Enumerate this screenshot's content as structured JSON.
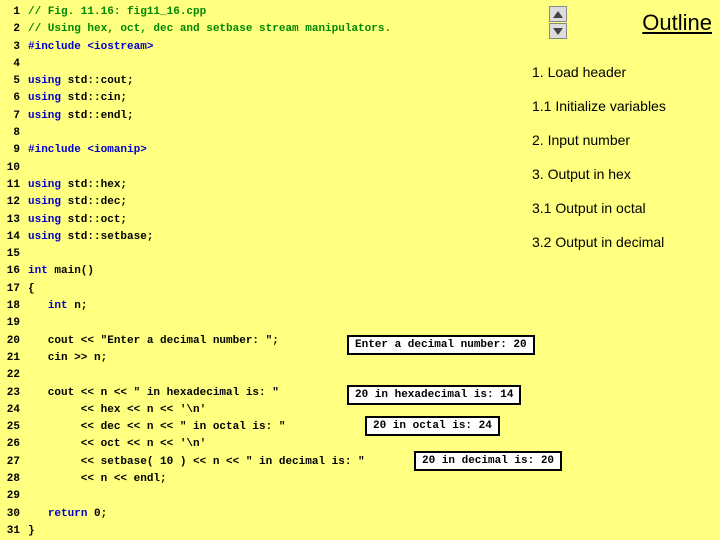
{
  "code": {
    "lines": [
      {
        "n": 1,
        "segs": [
          {
            "cls": "cmt",
            "t": "// Fig. 11.16: fig11_16.cpp"
          }
        ]
      },
      {
        "n": 2,
        "segs": [
          {
            "cls": "cmt",
            "t": "// Using hex, oct, dec and setbase stream manipulators."
          }
        ]
      },
      {
        "n": 3,
        "segs": [
          {
            "cls": "kwblue",
            "t": "#include <iostream>"
          }
        ]
      },
      {
        "n": 4,
        "segs": []
      },
      {
        "n": 5,
        "segs": [
          {
            "cls": "kwblue",
            "t": "using "
          },
          {
            "cls": "kw",
            "t": "std::cout;"
          }
        ]
      },
      {
        "n": 6,
        "segs": [
          {
            "cls": "kwblue",
            "t": "using "
          },
          {
            "cls": "kw",
            "t": "std::cin;"
          }
        ]
      },
      {
        "n": 7,
        "segs": [
          {
            "cls": "kwblue",
            "t": "using "
          },
          {
            "cls": "kw",
            "t": "std::endl;"
          }
        ]
      },
      {
        "n": 8,
        "segs": []
      },
      {
        "n": 9,
        "segs": [
          {
            "cls": "kwblue",
            "t": "#include <iomanip>"
          }
        ]
      },
      {
        "n": 10,
        "segs": []
      },
      {
        "n": 11,
        "segs": [
          {
            "cls": "kwblue",
            "t": "using "
          },
          {
            "cls": "kw",
            "t": "std::hex;"
          }
        ]
      },
      {
        "n": 12,
        "segs": [
          {
            "cls": "kwblue",
            "t": "using "
          },
          {
            "cls": "kw",
            "t": "std::dec;"
          }
        ]
      },
      {
        "n": 13,
        "segs": [
          {
            "cls": "kwblue",
            "t": "using "
          },
          {
            "cls": "kw",
            "t": "std::oct;"
          }
        ]
      },
      {
        "n": 14,
        "segs": [
          {
            "cls": "kwblue",
            "t": "using "
          },
          {
            "cls": "kw",
            "t": "std::setbase;"
          }
        ]
      },
      {
        "n": 15,
        "segs": []
      },
      {
        "n": 16,
        "segs": [
          {
            "cls": "kwblue",
            "t": "int "
          },
          {
            "cls": "kw",
            "t": "main()"
          }
        ]
      },
      {
        "n": 17,
        "segs": [
          {
            "cls": "kw",
            "t": "{"
          }
        ]
      },
      {
        "n": 18,
        "segs": [
          {
            "cls": "kw",
            "t": "   "
          },
          {
            "cls": "kwblue",
            "t": "int"
          },
          {
            "cls": "kw",
            "t": " n;"
          }
        ]
      },
      {
        "n": 19,
        "segs": []
      },
      {
        "n": 20,
        "segs": [
          {
            "cls": "kw",
            "t": "   cout << \"Enter a decimal number: \";"
          }
        ]
      },
      {
        "n": 21,
        "segs": [
          {
            "cls": "kw",
            "t": "   cin >> n;"
          }
        ]
      },
      {
        "n": 22,
        "segs": []
      },
      {
        "n": 23,
        "segs": [
          {
            "cls": "kw",
            "t": "   cout << n << \" in hexadecimal is: \""
          }
        ]
      },
      {
        "n": 24,
        "segs": [
          {
            "cls": "kw",
            "t": "        << hex << n << '\\n'"
          }
        ]
      },
      {
        "n": 25,
        "segs": [
          {
            "cls": "kw",
            "t": "        << dec << n << \" in octal is: \""
          }
        ]
      },
      {
        "n": 26,
        "segs": [
          {
            "cls": "kw",
            "t": "        << oct << n << '\\n'"
          }
        ]
      },
      {
        "n": 27,
        "segs": [
          {
            "cls": "kw",
            "t": "        << setbase( 10 ) << n << \" in decimal is: \""
          }
        ]
      },
      {
        "n": 28,
        "segs": [
          {
            "cls": "kw",
            "t": "        << n << endl;"
          }
        ]
      },
      {
        "n": 29,
        "segs": []
      },
      {
        "n": 30,
        "segs": [
          {
            "cls": "kw",
            "t": "   "
          },
          {
            "cls": "kwblue",
            "t": "return"
          },
          {
            "cls": "kw",
            "t": " 0;"
          }
        ]
      },
      {
        "n": 31,
        "segs": [
          {
            "cls": "kw",
            "t": "}"
          }
        ]
      }
    ]
  },
  "outline": {
    "title": "Outline",
    "items": [
      "1. Load header",
      "1.1 Initialize variables",
      "2. Input number",
      "3. Output in hex",
      "3.1 Output in octal",
      "3.2 Output in decimal"
    ]
  },
  "outputs": {
    "o1": "Enter a decimal number: 20",
    "o2": "20 in hexadecimal is: 14",
    "o3": "20 in octal is: 24",
    "o4": "20 in decimal is: 20"
  }
}
